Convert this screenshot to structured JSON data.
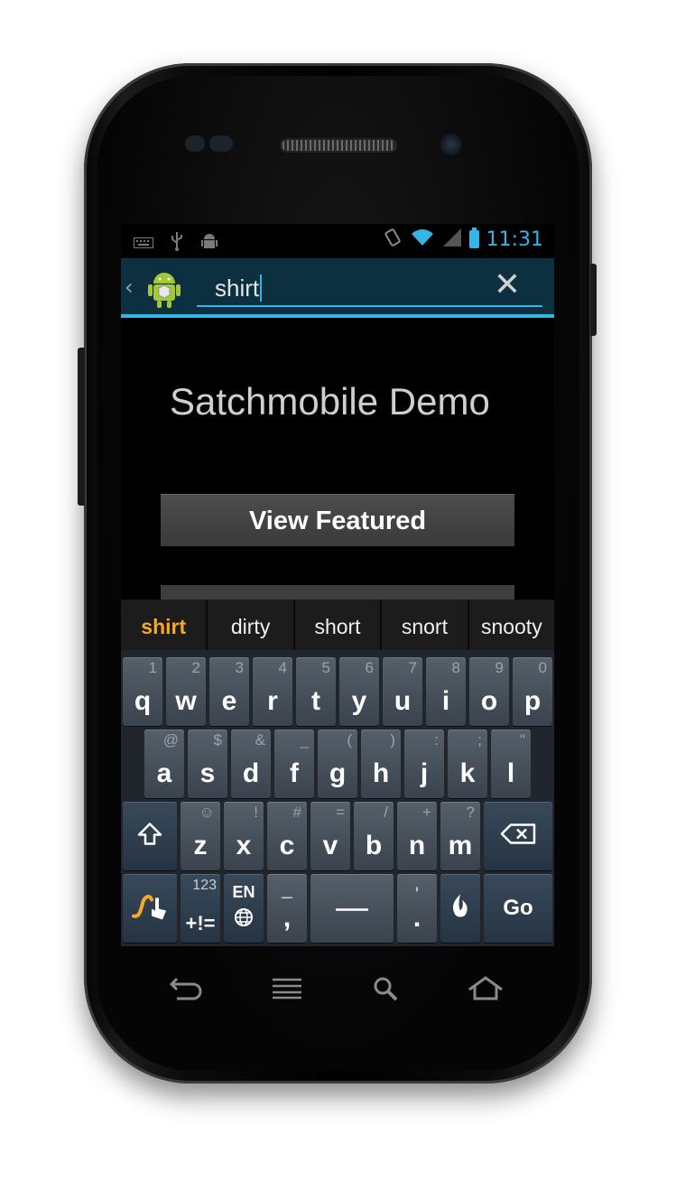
{
  "status_bar": {
    "time": "11:31",
    "left_icons": [
      "keyboard-icon",
      "usb-icon",
      "android-debug-icon"
    ],
    "right_icons": [
      "vibrate-icon",
      "wifi-icon",
      "signal-icon",
      "battery-icon"
    ]
  },
  "action_bar": {
    "search_value": "shirt",
    "back_icon": "chevron-left-icon",
    "app_icon": "android-box-icon",
    "clear_icon": "close-icon",
    "accent": "#33b5e5"
  },
  "main": {
    "title": "Satchmobile Demo",
    "featured_button": "View Featured"
  },
  "suggestions": [
    "shirt",
    "dirty",
    "short",
    "snort",
    "snooty"
  ],
  "keyboard": {
    "row1": [
      {
        "main": "q",
        "sub": "1"
      },
      {
        "main": "w",
        "sub": "2"
      },
      {
        "main": "e",
        "sub": "3"
      },
      {
        "main": "r",
        "sub": "4"
      },
      {
        "main": "t",
        "sub": "5"
      },
      {
        "main": "y",
        "sub": "6"
      },
      {
        "main": "u",
        "sub": "7"
      },
      {
        "main": "i",
        "sub": "8"
      },
      {
        "main": "o",
        "sub": "9"
      },
      {
        "main": "p",
        "sub": "0"
      }
    ],
    "row2": [
      {
        "main": "a",
        "sub": "@"
      },
      {
        "main": "s",
        "sub": "$"
      },
      {
        "main": "d",
        "sub": "&"
      },
      {
        "main": "f",
        "sub": "_"
      },
      {
        "main": "g",
        "sub": "("
      },
      {
        "main": "h",
        "sub": ")"
      },
      {
        "main": "j",
        "sub": ":"
      },
      {
        "main": "k",
        "sub": ";"
      },
      {
        "main": "l",
        "sub": "\""
      }
    ],
    "row3": [
      {
        "main": "z",
        "sub": "☺"
      },
      {
        "main": "x",
        "sub": "!"
      },
      {
        "main": "c",
        "sub": "#"
      },
      {
        "main": "v",
        "sub": "="
      },
      {
        "main": "b",
        "sub": "/"
      },
      {
        "main": "n",
        "sub": "+"
      },
      {
        "main": "m",
        "sub": "?"
      }
    ],
    "symbols_top": "123",
    "symbols_bottom": "+!=",
    "lang": "EN",
    "dash_key": "–",
    "comma_key": ",",
    "apostrophe_key": "'",
    "period_key": ".",
    "go_key": "Go"
  },
  "nav": [
    "back-icon",
    "menu-icon",
    "search-icon",
    "home-icon"
  ]
}
